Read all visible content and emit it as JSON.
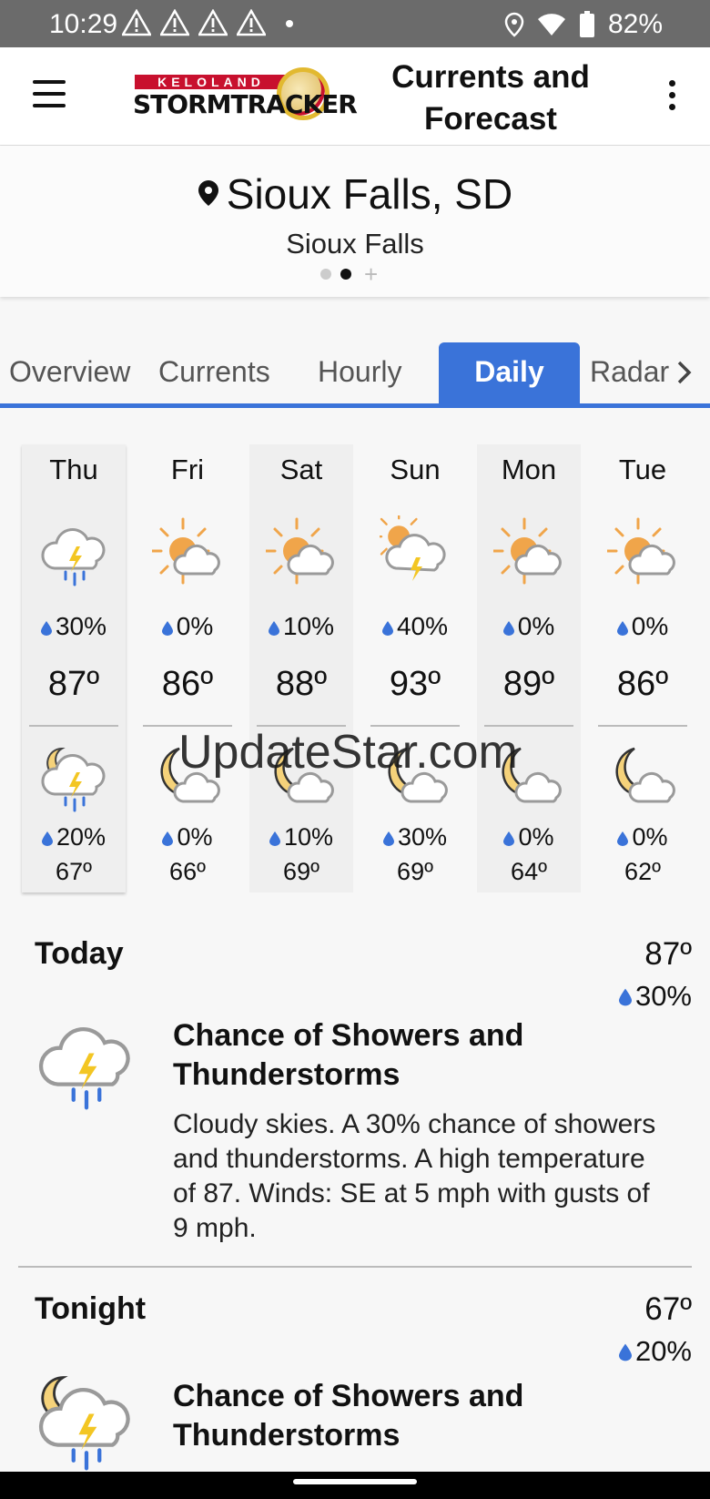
{
  "status_bar": {
    "time": "10:29",
    "battery": "82%",
    "icons": [
      "warning-icon",
      "warning-icon",
      "warning-icon",
      "warning-icon",
      "location-icon",
      "wifi-icon",
      "battery-icon"
    ]
  },
  "app_bar": {
    "logo_top": "KELOLAND",
    "logo_bottom": "STORMTRACKER",
    "title": "Currents and Forecast"
  },
  "location": {
    "title": "Sioux Falls, SD",
    "subtitle": "Sioux Falls",
    "pages": 2,
    "active_page": 1
  },
  "tabs": [
    {
      "label": "Overview"
    },
    {
      "label": "Currents"
    },
    {
      "label": "Hourly"
    },
    {
      "label": "Daily",
      "active": true
    },
    {
      "label": "Radar"
    }
  ],
  "colors": {
    "accent": "#3a73d9",
    "sun": "#f0a54a",
    "rain": "#3a73d9",
    "bolt": "#f3c623",
    "moon": "#f5d27a"
  },
  "days": [
    {
      "name": "Thu",
      "day_icon": "thunderstorm-icon",
      "day_precip": "30%",
      "high": "87º",
      "night_icon": "night-thunderstorm-icon",
      "night_precip": "20%",
      "low": "67º"
    },
    {
      "name": "Fri",
      "day_icon": "partly-sunny-icon",
      "day_precip": "0%",
      "high": "86º",
      "night_icon": "partly-cloudy-night-icon",
      "night_precip": "0%",
      "low": "66º"
    },
    {
      "name": "Sat",
      "day_icon": "partly-sunny-icon",
      "day_precip": "10%",
      "high": "88º",
      "night_icon": "partly-cloudy-night-icon",
      "night_precip": "10%",
      "low": "69º"
    },
    {
      "name": "Sun",
      "day_icon": "sun-thunder-icon",
      "day_precip": "40%",
      "high": "93º",
      "night_icon": "partly-cloudy-night-icon",
      "night_precip": "30%",
      "low": "69º"
    },
    {
      "name": "Mon",
      "day_icon": "partly-sunny-icon",
      "day_precip": "0%",
      "high": "89º",
      "night_icon": "partly-cloudy-night-icon",
      "night_precip": "0%",
      "low": "64º"
    },
    {
      "name": "Tue",
      "day_icon": "partly-sunny-icon",
      "day_precip": "0%",
      "high": "86º",
      "night_icon": "partly-cloudy-night-icon",
      "night_precip": "0%",
      "low": "62º"
    }
  ],
  "watermark": "UpdateStar.com",
  "periods": [
    {
      "title": "Today",
      "temp": "87º",
      "precip": "30%",
      "icon": "thunderstorm-icon",
      "condition": "Chance of Showers and Thunderstorms",
      "description": "Cloudy skies.  A 30% chance of showers and thunderstorms.  A high temperature of 87.  Winds: SE at 5 mph with gusts of 9 mph."
    },
    {
      "title": "Tonight",
      "temp": "67º",
      "precip": "20%",
      "icon": "night-thunderstorm-icon",
      "condition": "Chance of Showers and Thunderstorms"
    }
  ]
}
